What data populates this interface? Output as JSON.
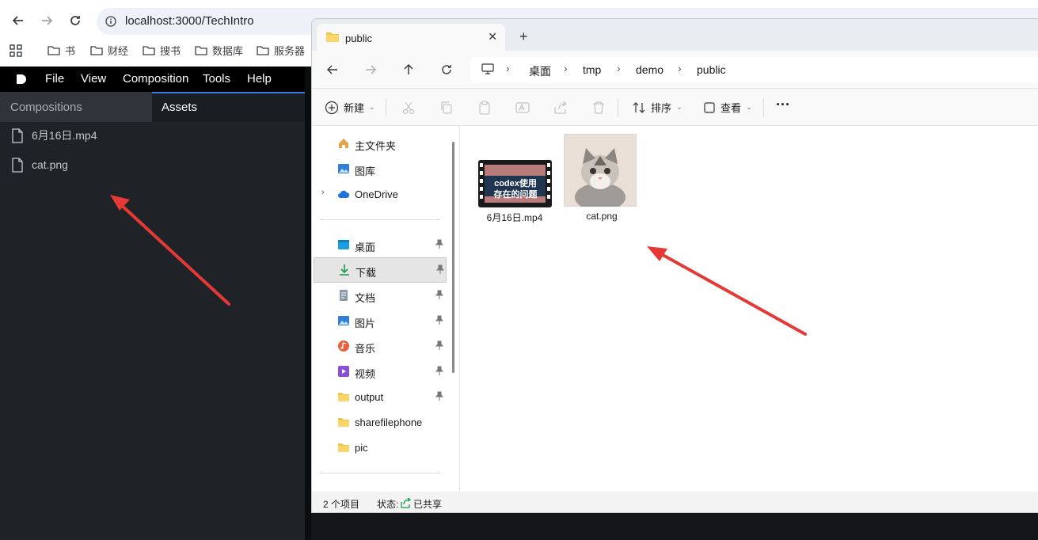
{
  "browser": {
    "url": "localhost:3000/TechIntro",
    "bookmarks": [
      "书",
      "财经",
      "搜书",
      "数据库",
      "服务器"
    ]
  },
  "app": {
    "menu": [
      "File",
      "View",
      "Composition",
      "Tools",
      "Help"
    ],
    "tabs": {
      "compositions": "Compositions",
      "assets": "Assets"
    },
    "assets": [
      {
        "name": "6月16日.mp4",
        "icon": "file-icon"
      },
      {
        "name": "cat.png",
        "icon": "file-icon"
      }
    ],
    "colors": {
      "menubar": "#000000",
      "panel": "#1f2227",
      "accent": "#2f7fe0",
      "annotation_arrow": "#e53935"
    }
  },
  "explorer": {
    "tab_title": "public",
    "breadcrumbs": [
      "桌面",
      "tmp",
      "demo",
      "public"
    ],
    "toolbar": {
      "new_label": "新建",
      "sort_label": "排序",
      "view_label": "查看",
      "more_label": "···"
    },
    "nav": {
      "top": [
        {
          "label": "主文件夹",
          "icon": "home-icon"
        },
        {
          "label": "图库",
          "icon": "gallery-icon"
        },
        {
          "label": "OneDrive",
          "icon": "cloud-icon"
        }
      ],
      "quick": [
        {
          "label": "桌面",
          "icon": "desktop-icon",
          "pinned": true
        },
        {
          "label": "下载",
          "icon": "download-icon",
          "pinned": true,
          "selected": true
        },
        {
          "label": "文档",
          "icon": "document-icon",
          "pinned": true
        },
        {
          "label": "图片",
          "icon": "pictures-icon",
          "pinned": true
        },
        {
          "label": "音乐",
          "icon": "music-icon",
          "pinned": true
        },
        {
          "label": "视频",
          "icon": "video-icon",
          "pinned": true
        },
        {
          "label": "output",
          "icon": "folder-icon",
          "pinned": true
        },
        {
          "label": "sharefilephone",
          "icon": "folder-icon",
          "pinned": false
        },
        {
          "label": "pic",
          "icon": "folder-icon",
          "pinned": false
        }
      ]
    },
    "files": [
      {
        "name": "6月16日.mp4",
        "thumb_text_1": "codex使用",
        "thumb_text_2": "存在的问题"
      },
      {
        "name": "cat.png"
      }
    ],
    "status": {
      "count": "2 个项目",
      "state_label": "状态:",
      "state_value": "已共享"
    }
  }
}
